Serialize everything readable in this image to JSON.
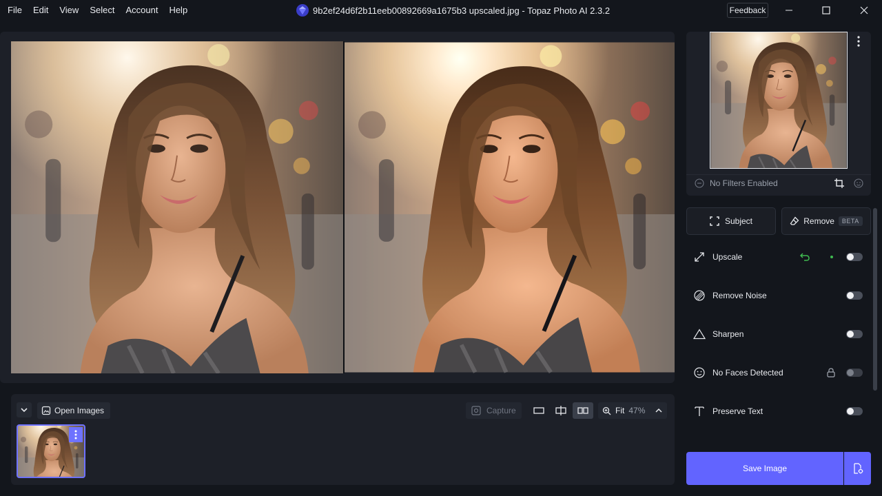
{
  "menu": {
    "file": "File",
    "edit": "Edit",
    "view": "View",
    "select": "Select",
    "account": "Account",
    "help": "Help"
  },
  "window": {
    "title": "9b2ef24d6f2b11eeb00892669a1675b3 upscaled.jpg - Topaz Photo AI 2.3.2",
    "feedback": "Feedback"
  },
  "strip": {
    "open_images": "Open Images",
    "capture": "Capture",
    "zoom_mode": "Fit",
    "zoom_pct": "47%"
  },
  "preview": {
    "filters_status": "No Filters Enabled"
  },
  "actions": {
    "subject": "Subject",
    "remove": "Remove",
    "beta": "BETA"
  },
  "tools": [
    {
      "label": "Upscale",
      "enabled": false
    },
    {
      "label": "Remove Noise",
      "enabled": false
    },
    {
      "label": "Sharpen",
      "enabled": false
    },
    {
      "label": "No Faces Detected",
      "enabled": false,
      "locked": true
    },
    {
      "label": "Preserve Text",
      "enabled": false
    }
  ],
  "save": {
    "label": "Save Image"
  },
  "colors": {
    "accent": "#6264ff",
    "panel": "#1d2028",
    "background": "#13161c",
    "undo_green": "#3fb950"
  }
}
